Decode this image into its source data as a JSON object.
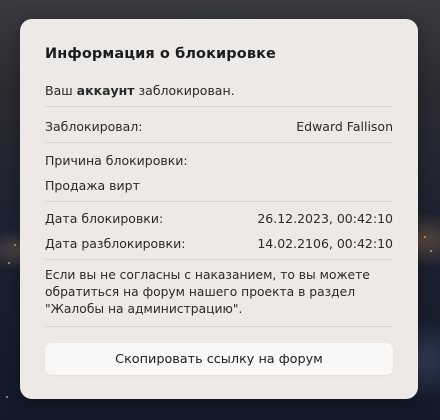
{
  "dialog": {
    "title": "Информация о блокировке",
    "status": {
      "prefix": "Ваш",
      "emphasis": "аккаунт",
      "suffix": "заблокирован."
    },
    "blocked_by": {
      "label": "Заблокировал:",
      "value": "Edward Fallison"
    },
    "reason": {
      "label": "Причина блокировки:",
      "value": "Продажа вирт"
    },
    "block_date": {
      "label": "Дата блокировки:",
      "value": "26.12.2023, 00:42:10"
    },
    "unblock_date": {
      "label": "Дата разблокировки:",
      "value": "14.02.2106, 00:42:10"
    },
    "notice": "Если вы не согласны с наказанием, то вы можете обратиться на форум нашего проекта в раздел \"Жалобы на администрацию\".",
    "copy_button_label": "Скопировать ссылку на форум"
  },
  "colors": {
    "card_background": "#ede9e6",
    "button_background": "#faf8f7",
    "divider": "#d9d4d0",
    "text": "#2a2a2a"
  }
}
